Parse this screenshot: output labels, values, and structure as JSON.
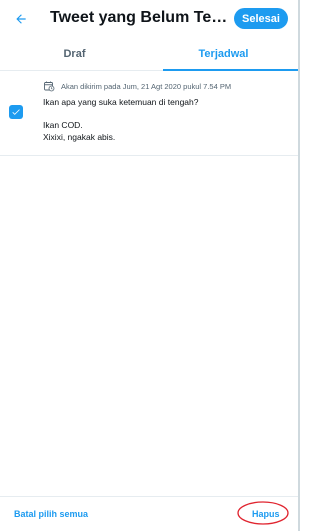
{
  "header": {
    "title": "Tweet yang Belum Terkirim",
    "done_label": "Selesai"
  },
  "tabs": [
    {
      "label": "Draf"
    },
    {
      "label": "Terjadwal"
    }
  ],
  "tweets": [
    {
      "schedule": "Akan dikirim pada Jum, 21 Agt 2020 pukul 7.54 PM",
      "lines": [
        "Ikan apa yang suka ketemuan di tengah?",
        "",
        "Ikan COD.",
        "Xixixi, ngakak abis."
      ],
      "checked": true
    }
  ],
  "footer": {
    "deselect_label": "Batal pilih semua",
    "delete_label": "Hapus"
  },
  "colors": {
    "accent": "#1d9bf0",
    "annotation": "#e0242f"
  }
}
